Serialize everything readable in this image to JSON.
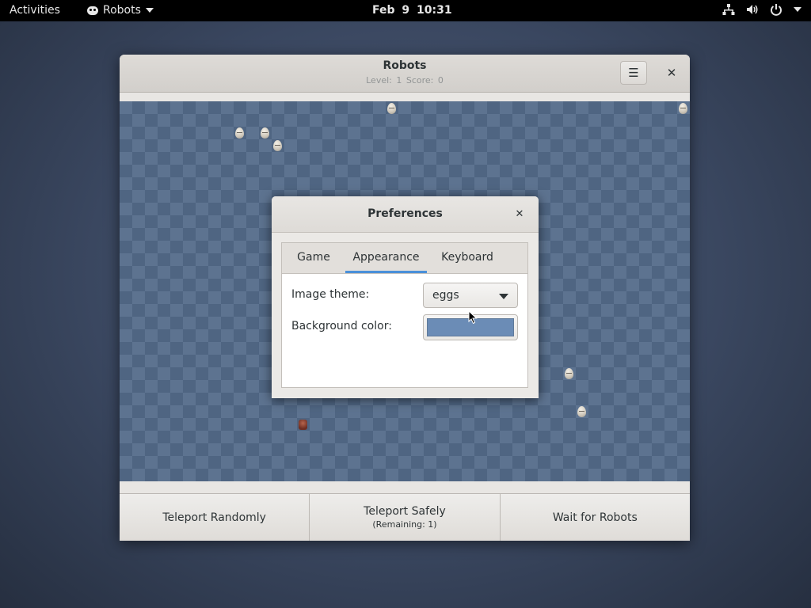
{
  "topbar": {
    "activities": "Activities",
    "app_name": "Robots",
    "clock": "Feb 9  10:31",
    "icons": [
      "network-icon",
      "volume-icon",
      "power-icon",
      "chevron-down-icon"
    ]
  },
  "window": {
    "title": "Robots",
    "subtitle": "Level: 1   Score: 0",
    "menu_icon": "☰",
    "close_icon": "✕",
    "board_color": "#5d7390"
  },
  "buttons": {
    "teleport_randomly": "Teleport Randomly",
    "teleport_safely": "Teleport Safely",
    "teleport_safely_sub": "(Remaining: 1)",
    "wait": "Wait for Robots"
  },
  "preferences": {
    "title": "Preferences",
    "close_icon": "✕",
    "tabs": [
      "Game",
      "Appearance",
      "Keyboard"
    ],
    "active_tab": "Appearance",
    "image_theme_label": "Image theme:",
    "image_theme_value": "eggs",
    "background_color_label": "Background color:",
    "background_color_value": "#6b8cb6"
  }
}
